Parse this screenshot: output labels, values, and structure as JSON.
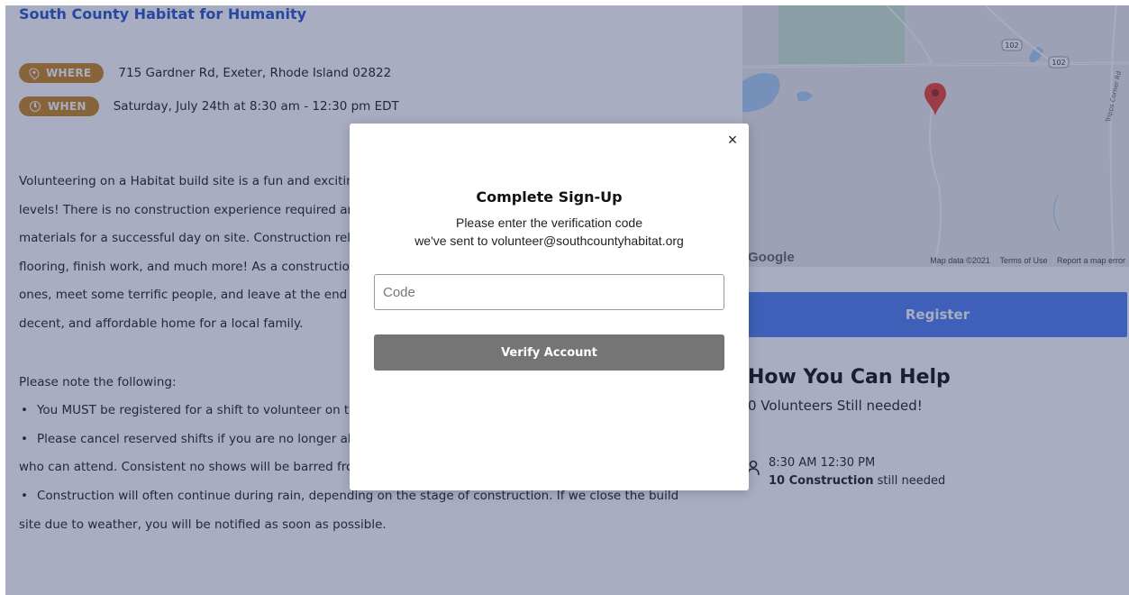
{
  "event": {
    "org_title": "South County Habitat for Humanity",
    "where_label": "WHERE",
    "where_value": "715 Gardner Rd, Exeter, Rhode Island 02822",
    "when_label": "WHEN",
    "when_value": "Saturday, July 24th at 8:30 am - 12:30 pm EDT"
  },
  "description": {
    "lines": [
      "Volunteering on a Habitat build site is a fun and exciting",
      "levels! There is no construction experience required and",
      "materials for a successful day on site. Construction relat",
      "flooring, finish work, and much more! As a construction",
      "ones, meet some terrific people, and leave at the end of",
      "decent, and affordable home for a local family."
    ],
    "note_heading": "Please note the following:",
    "bullet_1": "You MUST be registered for a shift to volunteer on th",
    "bullet_2": "Please cancel reserved shifts if you are no longer abl",
    "bullet_2_cont": "who can attend. Consistent no shows will be barred fro",
    "bullet_3": "Construction will often continue during rain, depending on the stage of construction. If we close the build",
    "bullet_3_cont": "site due to weather, you will be notified as soon as possible."
  },
  "map": {
    "logo_text": "Google",
    "road_label_1": "102",
    "road_label_2": "102",
    "street_label": "Tripps Corner Rd",
    "footer_data": "Map data ©2021",
    "footer_terms": "Terms of Use",
    "footer_report": "Report a map error"
  },
  "sidebar": {
    "register_label": "Register",
    "help_title": "How You Can Help",
    "help_sub": "0 Volunteers Still needed!",
    "shift_time": "8:30 AM 12:30 PM",
    "shift_need_bold": "10 Construction",
    "shift_need_rest": " still needed"
  },
  "modal": {
    "close_label": "×",
    "title": "Complete Sign-Up",
    "line_1": "Please enter the verification code",
    "line_2": "we've sent to volunteer@southcountyhabitat.org",
    "code_placeholder": "Code",
    "code_value": "",
    "verify_label": "Verify Account"
  },
  "colors": {
    "brand_blue": "#2a56c6",
    "pill_orange": "#c9861f",
    "register_blue": "#4f7ff0",
    "verify_gray": "#757575",
    "overlay": "rgba(37,49,100,0.40)"
  }
}
